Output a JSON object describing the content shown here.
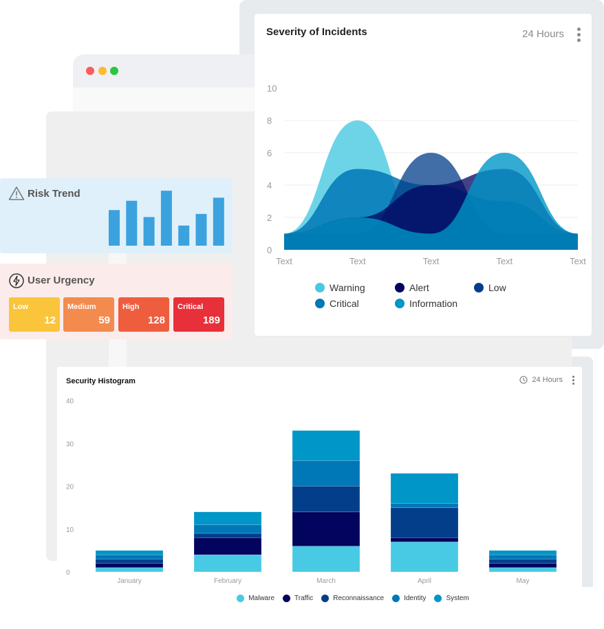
{
  "window": {
    "traffic_lights": [
      {
        "name": "close",
        "color": "#fc5c5c"
      },
      {
        "name": "minimize",
        "color": "#fdbb2d"
      },
      {
        "name": "maximize",
        "color": "#27c840"
      }
    ]
  },
  "severity_card": {
    "title": "Severity of Incidents",
    "period": "24 Hours",
    "menu_icon": "kebab-menu-icon"
  },
  "risk_trend": {
    "title": "Risk Trend",
    "icon": "warning-triangle-icon",
    "bar_color": "#3ba2de",
    "values": [
      46,
      58,
      37,
      71,
      26,
      41,
      62
    ]
  },
  "user_urgency": {
    "title": "User Urgency",
    "icon": "lightning-bolt-icon",
    "tiles": [
      {
        "label": "Low",
        "value": "12",
        "color": "#fbc53b"
      },
      {
        "label": "Medium",
        "value": "59",
        "color": "#f38b4e"
      },
      {
        "label": "High",
        "value": "128",
        "color": "#ee5d3e"
      },
      {
        "label": "Critical",
        "value": "189",
        "color": "#e8303a"
      }
    ]
  },
  "histogram_card": {
    "title": "Security Histogram",
    "period": "24 Hours",
    "clock_icon": "clock-icon",
    "menu_icon": "kebab-menu-icon"
  },
  "chart_data": [
    {
      "type": "area",
      "title": "Severity of Incidents",
      "x": [
        "Text",
        "Text",
        "Text",
        "Text",
        "Text"
      ],
      "xlabel": "",
      "ylabel": "",
      "ylim": [
        0,
        10
      ],
      "yticks": [
        0,
        2,
        4,
        6,
        8,
        10
      ],
      "grid": true,
      "legend": "bottom",
      "series": [
        {
          "name": "Warning",
          "color": "#48c9e2",
          "values": [
            1,
            8,
            0,
            1,
            1
          ]
        },
        {
          "name": "Critical",
          "color": "#0077b6",
          "values": [
            1,
            5,
            4,
            3,
            1
          ]
        },
        {
          "name": "Alert",
          "color": "#03045e",
          "values": [
            1,
            2,
            4,
            5,
            1
          ]
        },
        {
          "name": "Low",
          "color": "#023e8a",
          "values": [
            1,
            1,
            6,
            1,
            1
          ]
        },
        {
          "name": "Information",
          "color": "#0096c7",
          "values": [
            1,
            2,
            1,
            6,
            1
          ]
        }
      ]
    },
    {
      "type": "bar",
      "stacked": true,
      "title": "Security Histogram",
      "categories": [
        "January",
        "February",
        "March",
        "April",
        "May"
      ],
      "xlabel": "",
      "ylabel": "",
      "ylim": [
        0,
        40
      ],
      "yticks": [
        0,
        10,
        20,
        30,
        40
      ],
      "grid": false,
      "legend": "bottom",
      "series": [
        {
          "name": "Malware",
          "color": "#48cae4",
          "values": [
            1,
            4,
            6,
            7,
            1
          ]
        },
        {
          "name": "Traffic",
          "color": "#03045e",
          "values": [
            1,
            4,
            8,
            1,
            1
          ]
        },
        {
          "name": "Reconnaissance",
          "color": "#023e8a",
          "values": [
            1,
            1,
            6,
            7,
            1
          ]
        },
        {
          "name": "Identity",
          "color": "#0077b6",
          "values": [
            1,
            2,
            6,
            1,
            1
          ]
        },
        {
          "name": "System",
          "color": "#0096c7",
          "values": [
            1,
            3,
            7,
            7,
            1
          ]
        }
      ]
    }
  ]
}
